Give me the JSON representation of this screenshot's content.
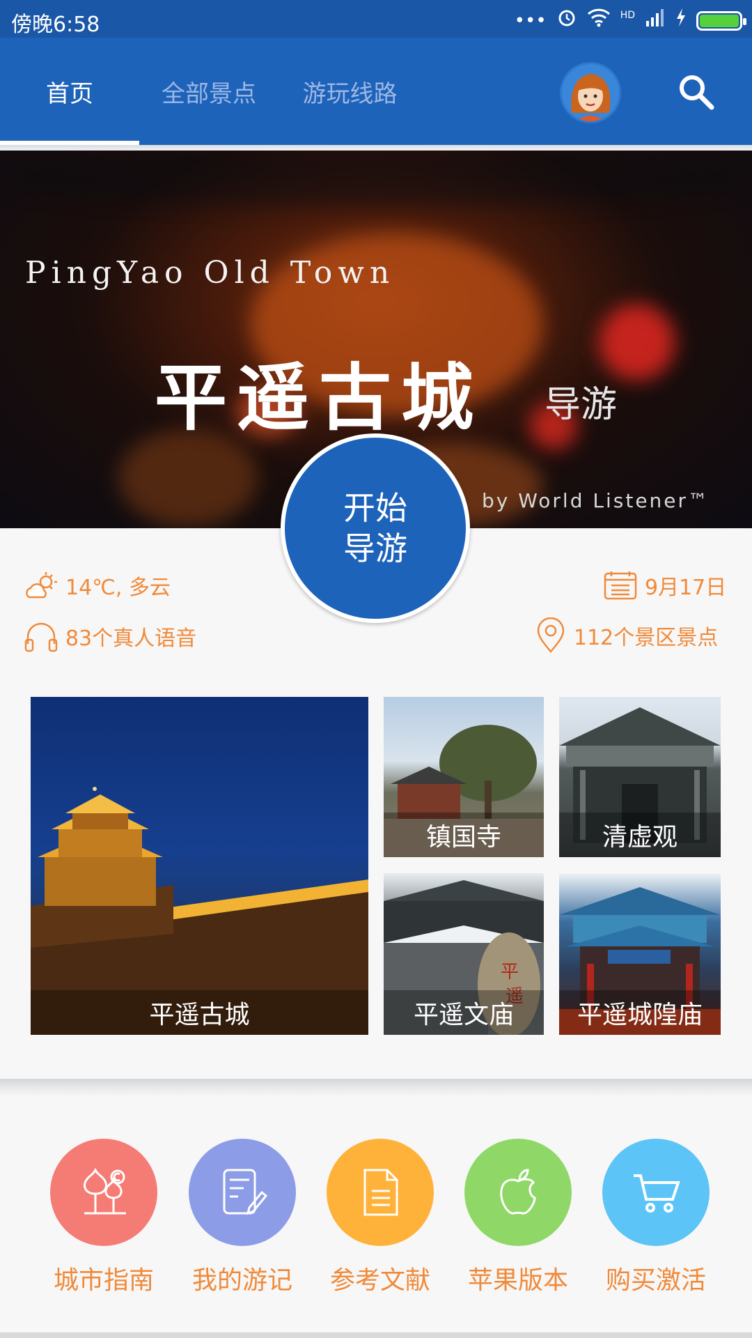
{
  "status_bar": {
    "time": "傍晚6:58",
    "icons": [
      "more-dots-icon",
      "alarm-icon",
      "wifi-icon",
      "hd-signal-icon",
      "signal-icon",
      "charging-icon",
      "battery-icon"
    ],
    "hd_label": "HD",
    "battery_color": "#55d23b"
  },
  "header": {
    "tabs": [
      {
        "label": "首页",
        "selected": true
      },
      {
        "label": "全部景点",
        "selected": false
      },
      {
        "label": "游玩线路",
        "selected": false
      }
    ],
    "avatar_icon": "user-avatar",
    "search_icon": "search-icon",
    "color": "#1d63ba"
  },
  "banner": {
    "title_en": "PingYao Old Town",
    "title_zh": "平遥古城",
    "subtitle_zh": "导游",
    "byline": "by World Listener™"
  },
  "start_button": {
    "line1": "开始",
    "line2": "导游"
  },
  "info": {
    "weather": "14℃, 多云",
    "date": "9月17日",
    "audio": "83个真人语音",
    "spots": "112个景区景点"
  },
  "attractions": [
    {
      "name": "平遥古城",
      "featured": true
    },
    {
      "name": "镇国寺"
    },
    {
      "name": "清虚观"
    },
    {
      "name": "平遥文庙"
    },
    {
      "name": "平遥城隍庙"
    }
  ],
  "menu": [
    {
      "label": "城市指南",
      "icon": "city-guide-icon",
      "color": "#f57c75"
    },
    {
      "label": "我的游记",
      "icon": "travel-notes-icon",
      "color": "#8c9ce6"
    },
    {
      "label": "参考文献",
      "icon": "document-icon",
      "color": "#ffb23a"
    },
    {
      "label": "苹果版本",
      "icon": "apple-icon",
      "color": "#8fd867"
    },
    {
      "label": "购买激活",
      "icon": "cart-icon",
      "color": "#5cc4f7"
    }
  ]
}
